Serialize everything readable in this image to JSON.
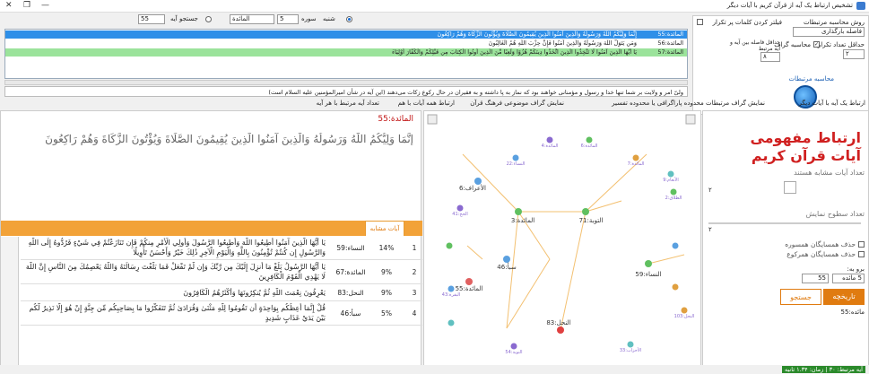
{
  "window": {
    "title": "تشخیص ارتباط یک آیه از قرآن کریم با آیات دیگر"
  },
  "topbar": {
    "label_surah": "سوره",
    "surah_number": "5",
    "surah_name": "المائدة",
    "label_ayah": "آیه",
    "ayah_number": "55",
    "radio_suleimani": "شنبه",
    "radio_jozi": "جستجو"
  },
  "results": {
    "rows": [
      {
        "ref": "المائدة:55",
        "text": "إِنَّمَا وَلِيُّكُمُ اللَّهُ وَرَسُولُهُ وَالَّذِينَ آمَنُوا الَّذِينَ يُقِيمُونَ الصَّلَاةَ وَيُؤْتُونَ الزَّكَاةَ وَهُمْ رَاكِعُونَ",
        "highlight": "blue"
      },
      {
        "ref": "المائدة:56",
        "text": "وَمَن يَتَوَلَّ اللَّهَ وَرَسُولَهُ وَالَّذِينَ آمَنُوا فَإِنَّ حِزْبَ اللَّهِ هُمُ الْغَالِبُونَ",
        "highlight": "none"
      },
      {
        "ref": "المائدة:57",
        "text": "يَا أَيُّهَا الَّذِينَ آمَنُوا لَا تَتَّخِذُوا الَّذِينَ اتَّخَذُوا دِينَكُمْ هُزُوًا وَلَعِبًا مِّنَ الَّذِينَ أُوتُوا الْكِتَابَ مِن قَبْلِكُمْ وَالْكُفَّارَ أَوْلِيَاءَ",
        "highlight": "green"
      }
    ],
    "info_text": "ولیّ امر و ولایت بر شما تنها خدا و رسول و مؤمنانی خواهند بود که نماز به پا داشته و به فقیران در حال رکوع زکات می‌دهند (این آیه در شأن امیرالمؤمنین علیه السلام است)"
  },
  "settings": {
    "label_surah_similarity": "روش محاسبه مرتبطات",
    "option_similarity": "فاصله بارگذاری",
    "checkbox_fewer_words": "فیلتر کردن کلمات پر تکرار",
    "label_min_repeat": "حداقل تعداد تکرار",
    "min_repeat_value": "۲",
    "label_distance": "حداقل فاصله بین آیه و آیه مرتبط",
    "distance_value": "۸",
    "checkbox_compute": "محاسبه گراف",
    "label_calc": "محاسبه مرتبطات"
  },
  "tabs": [
    "ارتباط یک آیه با آیات دیگر",
    "نمایش گراف مرتبطات محدوده پاراگرافی یا محدوده تفسیر",
    "نمایش گراف موضوعی فرهنگ قرآن",
    "ارتباط همه آیات با هم",
    "تعداد آیه مرتبط با هر آیه"
  ],
  "verse": {
    "ref": "المائدة:55",
    "text": "إِنَّمَا وَلِيُّكُمُ اللَّهُ وَرَسُولُهُ وَالَّذِينَ آمَنُوا الَّذِينَ يُقِيمُونَ الصَّلَاةَ وَيُؤْتُونَ الزَّكَاةَ وَهُمْ رَاكِعُونَ"
  },
  "similar": {
    "tab_label": "آیات مشابه",
    "rows": [
      {
        "num": "1",
        "pct": "14%",
        "ref": "النساء:59",
        "text": "يَا أَيُّهَا الَّذِينَ آمَنُوا أَطِيعُوا اللَّهَ وَأَطِيعُوا الرَّسُولَ وَأُولِي الْأَمْرِ مِنكُمْ فَإِن تَنَازَعْتُمْ فِي شَيْءٍ فَرُدُّوهُ إِلَى اللَّهِ وَالرَّسُولِ إِن كُنتُمْ تُؤْمِنُونَ بِاللَّهِ وَالْيَوْمِ الْآخِرِ ذَٰلِكَ خَيْرٌ وَأَحْسَنُ تَأْوِيلًا"
      },
      {
        "num": "2",
        "pct": "9%",
        "ref": "المائدة:67",
        "text": "يَا أَيُّهَا الرَّسُولُ بَلِّغْ مَا أُنزِلَ إِلَيْكَ مِن رَّبِّكَ وَإِن لَّمْ تَفْعَلْ فَمَا بَلَّغْتَ رِسَالَتَهُ وَاللَّهُ يَعْصِمُكَ مِنَ النَّاسِ إِنَّ اللَّهَ لَا يَهْدِي الْقَوْمَ الْكَافِرِينَ"
      },
      {
        "num": "3",
        "pct": "9%",
        "ref": "النحل:83",
        "text": "يَعْرِفُونَ نِعْمَتَ اللَّهِ ثُمَّ يُنكِرُونَهَا وَأَكْثَرُهُمُ الْكَافِرُونَ"
      },
      {
        "num": "4",
        "pct": "5%",
        "ref": "سبأ:46",
        "text": "قُلْ إِنَّمَا أَعِظُكُم بِوَاحِدَةٍ أَن تَقُومُوا لِلَّهِ مَثْنَىٰ وَفُرَادَىٰ ثُمَّ تَتَفَكَّرُوا مَا بِصَاحِبِكُم مِّن جِنَّةٍ إِنْ هُوَ إِلَّا نَذِيرٌ لَّكُم بَيْنَ يَدَيْ عَذَابٍ شَدِيدٍ"
      }
    ]
  },
  "graph": {
    "nodes": [
      {
        "label": "المائدة:55",
        "color": "#e06060"
      },
      {
        "label": "الأعراف:6",
        "color": "#5aa0e0"
      },
      {
        "label": "المائدة:3",
        "color": "#60c060"
      },
      {
        "label": "التوبة:71",
        "color": "#60c060"
      },
      {
        "label": "النحل:83",
        "color": "#e04040"
      },
      {
        "label": "سبأ:46",
        "color": "#5aa0e0"
      },
      {
        "label": "النساء:59",
        "color": "#60c060"
      }
    ]
  },
  "right": {
    "title_line1": "ارتباط مفهومی",
    "title_line2": "آیات قرآن کریم",
    "label_similar_levels": "تعداد آیات مشابه هستند",
    "levels_value": "۲",
    "label_show_levels": "تعداد سطوح نمایش",
    "show_levels_value": "۲",
    "checkbox_remove_neighbors": "حذف همسایگان همسوره",
    "checkbox_remove_neighbors2": "حذف همسایگان همرکوع",
    "label_goto": "برو به:",
    "goto_surah": "5 مائده",
    "goto_ayah": "55",
    "btn_search": "جستجو",
    "btn_history": "تاریخچه",
    "history_item": "مائده:55"
  },
  "status": {
    "text": "آیه مرتبط: ۳۰ | زمان: ۱.۳۴ ثانیه"
  },
  "colors": {
    "accent": "#f2a238",
    "selection": "#2e8fe8",
    "green_row": "#9be39b",
    "title_red": "#d02020"
  }
}
